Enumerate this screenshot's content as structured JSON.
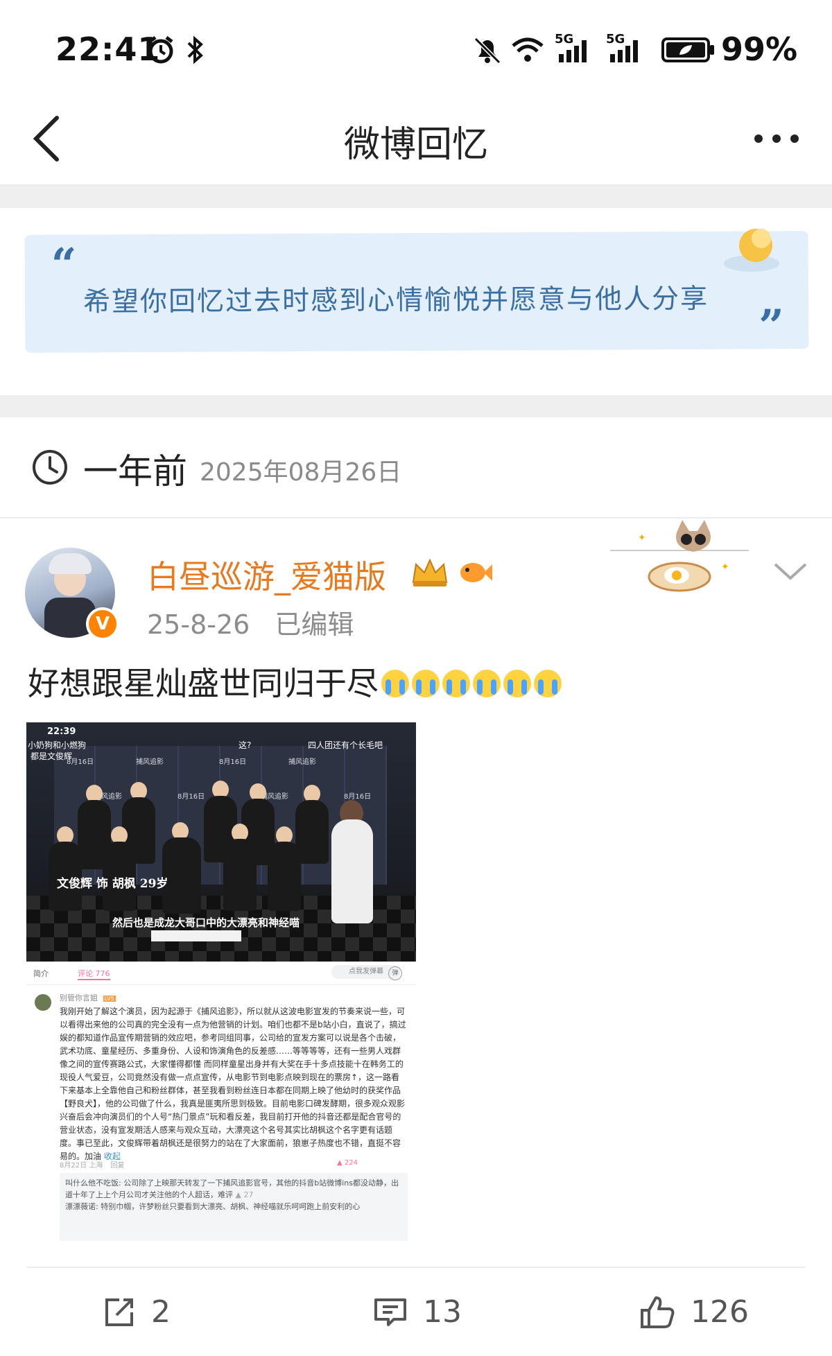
{
  "status_bar": {
    "time": "22:41",
    "battery": "99%",
    "icons": [
      "alarm-icon",
      "bluetooth-icon",
      "mute-icon",
      "wifi-icon",
      "signal-5g-icon",
      "signal-5g-icon",
      "battery-icon"
    ],
    "net_labels": [
      "5G",
      "5G"
    ]
  },
  "header": {
    "title": "微博回忆"
  },
  "banner": {
    "open_quote": "“",
    "text": "希望你回忆过去时感到心情愉悦并愿意与他人分享",
    "close_quote": "”",
    "bg_color": "#e3f0fb",
    "text_color": "#3a6fa5"
  },
  "memory": {
    "relative_time": "一年前",
    "date": "2025年08月26日"
  },
  "post": {
    "username": "白昼巡游_爱猫版",
    "username_color": "#e8791d",
    "verified_mark": "V",
    "meta_date": "25-8-26",
    "meta_edited": "已编辑",
    "text": "好想跟星灿盛世同归于尽",
    "emoji_count": 6
  },
  "embedded": {
    "status_time": "22:39",
    "top_left_caption": "小奶狗和小燃狗",
    "top_left_caption2": "都是文俊辉",
    "top_mid_caption": "这?",
    "top_right_caption": "四人团还有个长毛吧",
    "wall_text": [
      "8月16日",
      "捕风追影"
    ],
    "subtitle_name": "文俊辉 饰 胡枫 29岁",
    "subtitle_line": "然后也是成龙大哥口中的大漂亮和神经喵",
    "tab_intro": "简介",
    "tab_comments": "评论 776",
    "danmaku_btn": "点我发弹幕",
    "danmaku_symbol": "弹",
    "comment_user": "别管你言姐",
    "comment_level": "LV5",
    "comment_text": "我刚开始了解这个演员，因为起源于《捕风追影》，所以就从这波电影宣发的节奏来说一些，可以看得出来他的公司真的完全没有一点为他营销的计划。咱们也都不是b站小白，直说了，搞过娱的都知道作品宣传期营销的效应吧，参考同组同事，公司给的宣发方案可以说是各个击破，武术功底、童星经历、多重身份、人设和饰演角色的反差感……等等等等，还有一些男人戏群像之间的宣传赛路公式，大家懂得都懂 而同样童星出身并有大奖在手十多点技能十在韩务工的现役人气爱豆，公司竟然没有做一点点宣传，从电影节到电影点映到现在的票房↑，这一路看下来基本上全靠他自己和粉丝群体，甚至我看到粉丝连日本都在同期上映了他幼时的获奖作品【野良犬】，他的公司做了什么，我真是匪夷所思到极致。目前电影口碑发酵期，很多观众观影兴奋后会冲向演员们的个人号“热门景点”玩和看反差，我目前打开他的抖音还都是配合官号的营业状态，没有宣发期活人感来与观众互动，大漂亮这个名号其实比胡枫这个名字更有话题度。事已至此，文俊辉带着胡枫还是很努力的站在了大家面前，狼崽子热度也不错，直挺不容易的。加油",
    "comment_collapse": "收起",
    "comment_date": "8月22日 上海",
    "comment_reply_btn": "回复",
    "comment_likes": "224",
    "reply_text": "叫什么他不吃饭: 公司除了上映那天转发了一下捕风追影官号，其他的抖音b站微博ins都没动静，出道十年了上上个月公司才关注他的个人超话，难评",
    "reply_likes": "27",
    "reply_text2": "漂漂薇诺: 特别巾帼，许梦粉丝只要看到大漂亮、胡枫、神经喵就乐呵呵跑上前安利的心"
  },
  "actions": {
    "repost_count": "2",
    "comment_count": "13",
    "like_count": "126"
  }
}
